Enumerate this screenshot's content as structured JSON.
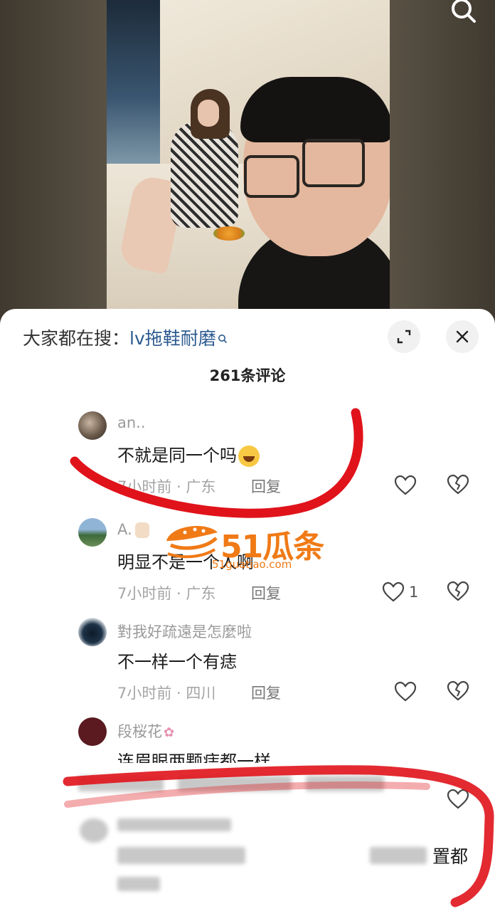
{
  "search_bar": {
    "prefix": "大家都在搜：",
    "term": "lv拖鞋耐磨"
  },
  "comment_count": "261条评论",
  "comments": [
    {
      "username": "an..",
      "text": "不就是同一个吗",
      "meta": "7小时前 · 广东",
      "reply": "回复",
      "likes": ""
    },
    {
      "username": "A.",
      "text": "明显不是一个人啊",
      "meta": "7小时前 · 广东",
      "reply": "回复",
      "likes": "1"
    },
    {
      "username": "對我好疏遠是怎麼啦",
      "text": "不一样一个有痣",
      "meta": "7小时前 · 四川",
      "reply": "回复",
      "likes": ""
    },
    {
      "username": "段桜花",
      "text": "连眉眼两颗痣都一样"
    }
  ],
  "truncated_text": "置都",
  "watermark": {
    "brand": "51瓜条",
    "domain": "51guatiao.com"
  },
  "colors": {
    "accent_link": "#2c5a8f",
    "annotation_red": "#e0131b",
    "watermark_orange": "#f07a16"
  }
}
